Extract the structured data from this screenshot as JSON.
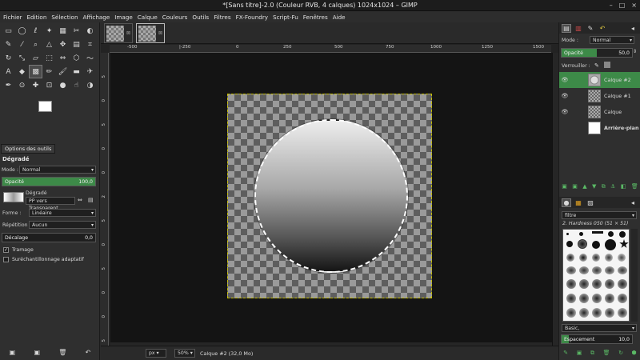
{
  "window": {
    "title": "*[Sans titre]-2.0 (Couleur RVB, 4 calques) 1024x1024 – GIMP",
    "controls": [
      "–",
      "□",
      "×"
    ]
  },
  "menu": [
    "Fichier",
    "Edition",
    "Sélection",
    "Affichage",
    "Image",
    "Calque",
    "Couleurs",
    "Outils",
    "Filtres",
    "FX-Foundry",
    "Script-Fu",
    "Fenêtres",
    "Aide"
  ],
  "tool_options": {
    "tab_label": "Options des outils",
    "heading": "Dégradé",
    "mode_label": "Mode :",
    "mode_value": "Normal",
    "opacity_label": "Opacité",
    "opacity_value": "100,0",
    "gradient_label": "Dégradé",
    "gradient_value": "PP vers Transparent",
    "shape_label": "Forme :",
    "shape_value": "Linéaire",
    "repeat_label": "Répétition :",
    "repeat_value": "Aucun",
    "offset_label": "Décalage",
    "offset_value": "0,0",
    "dither_label": "Tramage",
    "dither_checked": true,
    "supersample_label": "Suréchantillonnage adaptatif",
    "supersample_checked": false
  },
  "rulers": {
    "top": [
      "-500",
      "|-250",
      "0",
      "250",
      "500",
      "750",
      "1000",
      "1250",
      "1500"
    ],
    "left": [
      "5",
      "0",
      "5",
      "0",
      "0",
      "2",
      "5",
      "0",
      "5",
      "0",
      "0",
      "5"
    ]
  },
  "status": {
    "unit": "px",
    "zoom": "50%",
    "message": "Calque #2 (32,0 Mo)"
  },
  "layers_dock": {
    "mode_label": "Mode :",
    "mode_value": "Normal",
    "opacity_label": "Opacité",
    "opacity_value": "50,0",
    "lock_label": "Verrouiller :",
    "layers": [
      {
        "name": "Calque #2",
        "selected": true
      },
      {
        "name": "Calque #1",
        "selected": false
      },
      {
        "name": "Calque",
        "selected": false
      },
      {
        "name": "Arrière-plan",
        "selected": false
      }
    ]
  },
  "brushes_dock": {
    "filter_value": "filtre",
    "brush_name": "2. Hardness 050 (51 × 51)",
    "preset_value": "Basic,",
    "spacing_label": "Espacement",
    "spacing_value": "10,0"
  },
  "colors": {
    "accent": "#3d8a48",
    "foreground": "#ffffff",
    "background": "#000000"
  }
}
